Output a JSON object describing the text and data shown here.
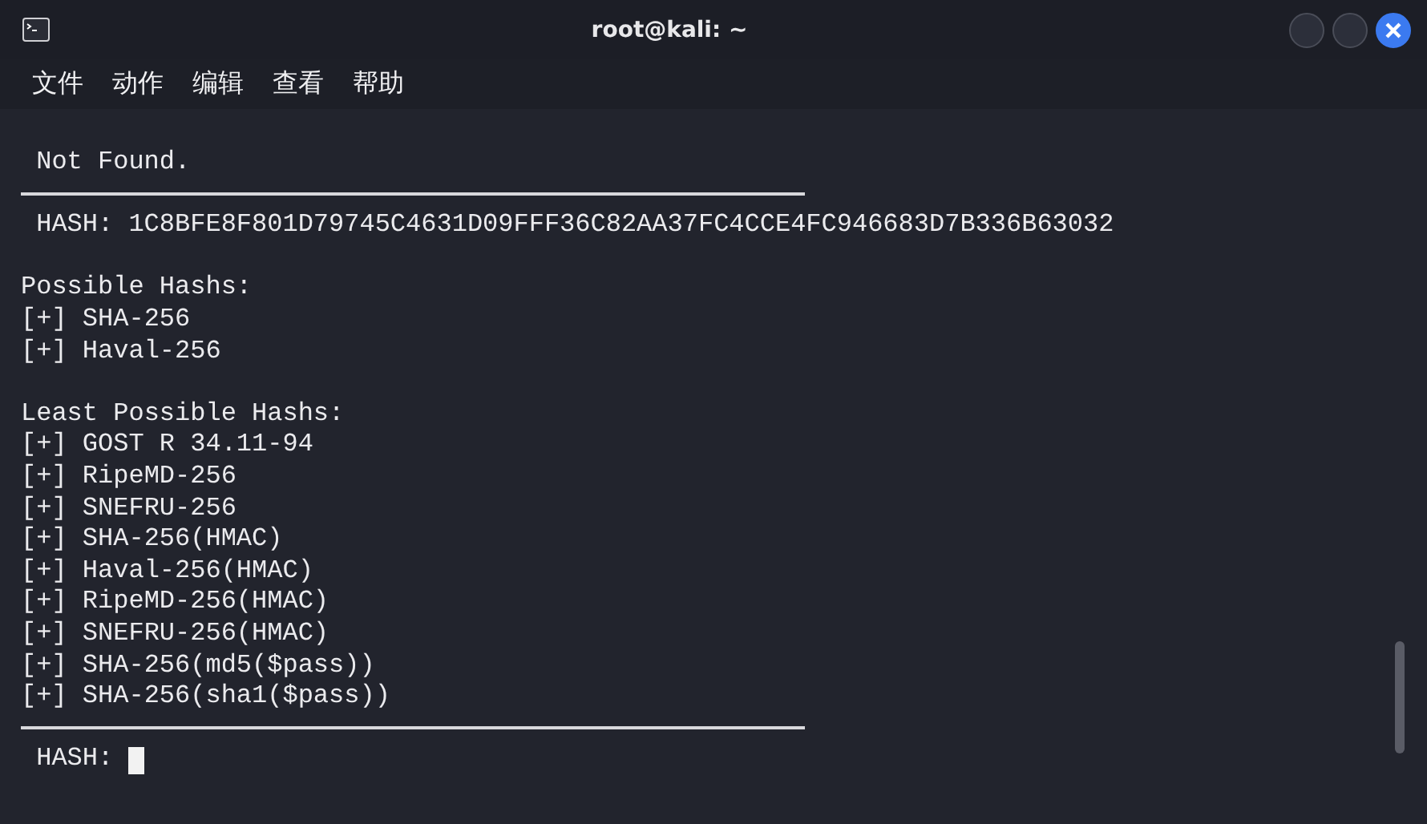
{
  "window": {
    "title": "root@kali: ~"
  },
  "menu": [
    "文件",
    "动作",
    "编辑",
    "查看",
    "帮助"
  ],
  "terminal": {
    "lines": [
      {
        "kind": "text",
        "text": "Not Found.",
        "indent": true
      },
      {
        "kind": "rule"
      },
      {
        "kind": "text",
        "text": "HASH: 1C8BFE8F801D79745C4631D09FFF36C82AA37FC4CCE4FC946683D7B336B63032",
        "indent": true
      },
      {
        "kind": "blank"
      },
      {
        "kind": "text",
        "text": "Possible Hashs:",
        "indent": false
      },
      {
        "kind": "text",
        "text": "[+] SHA-256",
        "indent": false
      },
      {
        "kind": "text",
        "text": "[+] Haval-256",
        "indent": false
      },
      {
        "kind": "blank"
      },
      {
        "kind": "text",
        "text": "Least Possible Hashs:",
        "indent": false
      },
      {
        "kind": "text",
        "text": "[+] GOST R 34.11-94",
        "indent": false
      },
      {
        "kind": "text",
        "text": "[+] RipeMD-256",
        "indent": false
      },
      {
        "kind": "text",
        "text": "[+] SNEFRU-256",
        "indent": false
      },
      {
        "kind": "text",
        "text": "[+] SHA-256(HMAC)",
        "indent": false
      },
      {
        "kind": "text",
        "text": "[+] Haval-256(HMAC)",
        "indent": false
      },
      {
        "kind": "text",
        "text": "[+] RipeMD-256(HMAC)",
        "indent": false
      },
      {
        "kind": "text",
        "text": "[+] SNEFRU-256(HMAC)",
        "indent": false
      },
      {
        "kind": "text",
        "text": "[+] SHA-256(md5($pass))",
        "indent": false
      },
      {
        "kind": "text",
        "text": "[+] SHA-256(sha1($pass))",
        "indent": false
      },
      {
        "kind": "rule"
      },
      {
        "kind": "prompt",
        "text": "HASH:",
        "indent": true
      }
    ]
  }
}
